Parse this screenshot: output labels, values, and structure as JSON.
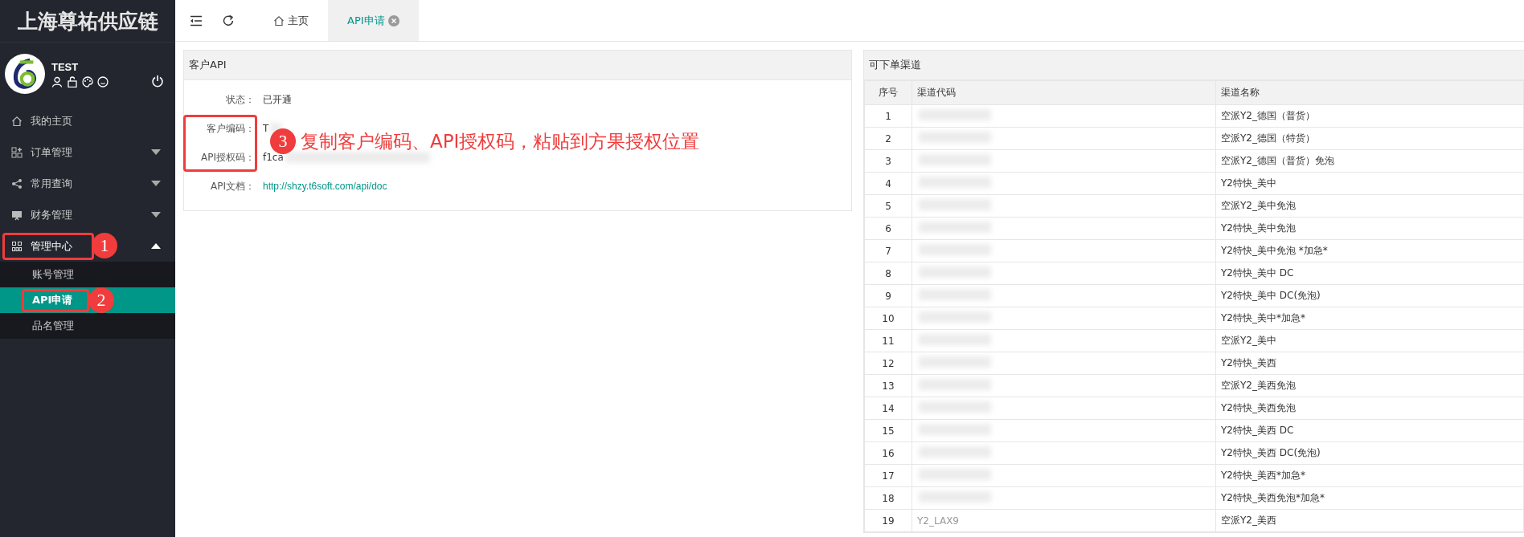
{
  "sidebar": {
    "brand": "上海尊祐供应链",
    "user": {
      "name": "TEST"
    },
    "menu": [
      {
        "kind": "link",
        "label": "我的主页"
      },
      {
        "kind": "group",
        "label": "订单管理",
        "expanded": false
      },
      {
        "kind": "group",
        "label": "常用查询",
        "expanded": false
      },
      {
        "kind": "group",
        "label": "财务管理",
        "expanded": false
      },
      {
        "kind": "group",
        "label": "管理中心",
        "expanded": true,
        "children": [
          {
            "label": "账号管理",
            "selected": false
          },
          {
            "label": "API申请",
            "selected": true
          },
          {
            "label": "品名管理",
            "selected": false
          }
        ]
      }
    ]
  },
  "tabs": [
    {
      "label": "主页",
      "selected": false,
      "closable": false
    },
    {
      "label": "API申请",
      "selected": true,
      "closable": true
    }
  ],
  "customer_api": {
    "title": "客户API",
    "fields": [
      {
        "kind": "text",
        "label": "状态：",
        "value": "已开通"
      },
      {
        "kind": "redacted",
        "label": "客户编码：",
        "value": "T"
      },
      {
        "kind": "redacted",
        "label": "API授权码：",
        "value": "f1ca"
      },
      {
        "kind": "link",
        "label": "API文档：",
        "value": "http://shzy.t6soft.com/api/doc"
      }
    ]
  },
  "channels": {
    "title": "可下单渠道",
    "columns": [
      "序号",
      "渠道代码",
      "渠道名称"
    ],
    "rows": [
      {
        "no": "1",
        "code_redacted": true,
        "name": "空派Y2_德国（普货）"
      },
      {
        "no": "2",
        "code_redacted": true,
        "name": "空派Y2_德国（特货）"
      },
      {
        "no": "3",
        "code_redacted": true,
        "name": "空派Y2_德国（普货）免泡"
      },
      {
        "no": "4",
        "code_redacted": true,
        "name": "Y2特快_美中"
      },
      {
        "no": "5",
        "code_redacted": true,
        "name": "空派Y2_美中免泡"
      },
      {
        "no": "6",
        "code_redacted": true,
        "name": "Y2特快_美中免泡"
      },
      {
        "no": "7",
        "code_redacted": true,
        "name": "Y2特快_美中免泡 *加急*"
      },
      {
        "no": "8",
        "code_redacted": true,
        "name": "Y2特快_美中 DC"
      },
      {
        "no": "9",
        "code_redacted": true,
        "name": "Y2特快_美中 DC(免泡)"
      },
      {
        "no": "10",
        "code_redacted": true,
        "name": "Y2特快_美中*加急*"
      },
      {
        "no": "11",
        "code_redacted": true,
        "name": "空派Y2_美中"
      },
      {
        "no": "12",
        "code_redacted": true,
        "name": "Y2特快_美西"
      },
      {
        "no": "13",
        "code_redacted": true,
        "name": "空派Y2_美西免泡"
      },
      {
        "no": "14",
        "code_redacted": true,
        "name": "Y2特快_美西免泡"
      },
      {
        "no": "15",
        "code_redacted": true,
        "name": "Y2特快_美西 DC"
      },
      {
        "no": "16",
        "code_redacted": true,
        "name": "Y2特快_美西 DC(免泡)"
      },
      {
        "no": "17",
        "code_redacted": true,
        "name": "Y2特快_美西*加急*"
      },
      {
        "no": "18",
        "code_redacted": true,
        "name": "Y2特快_美西免泡*加急*"
      },
      {
        "no": "19",
        "code_redacted": false,
        "code": "Y2_LAX9",
        "name": "空派Y2_美西"
      }
    ]
  },
  "annotations": [
    {
      "number": "1"
    },
    {
      "number": "2"
    },
    {
      "number": "3",
      "text": "复制客户编码、API授权码，粘贴到方果授权位置"
    }
  ]
}
